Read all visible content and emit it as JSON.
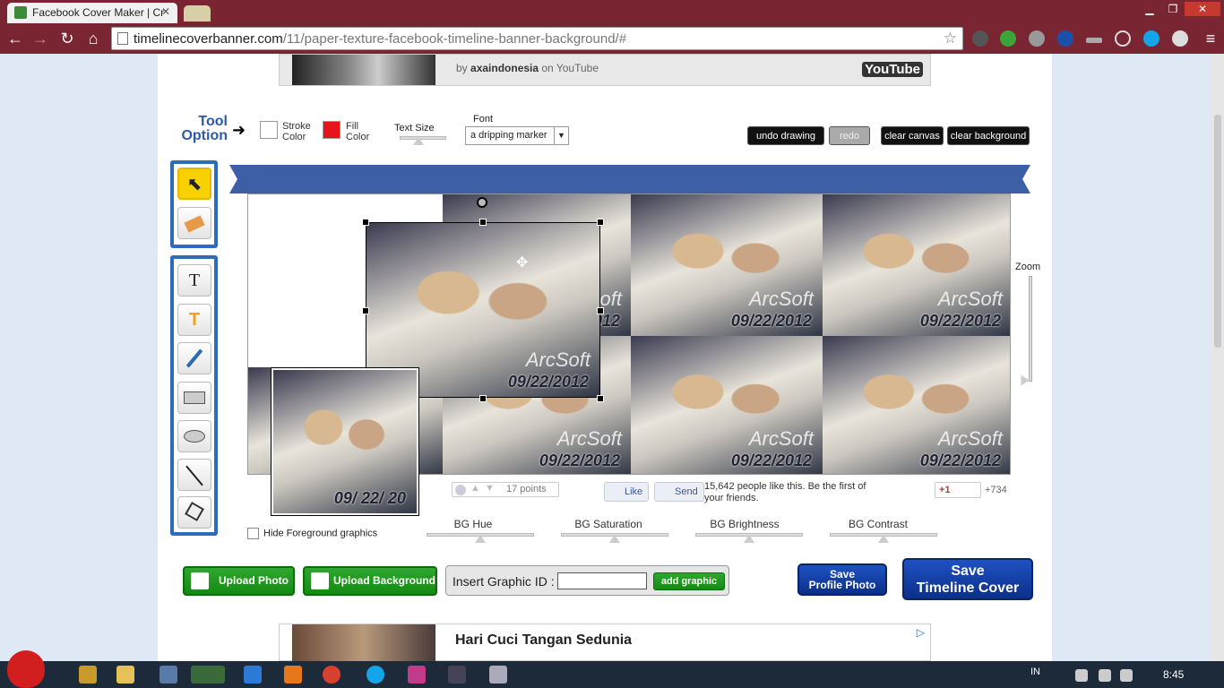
{
  "browser": {
    "tab_title": "Facebook Cover Maker | Cr",
    "tab_close": "✕",
    "url_host": "timelinecoverbanner.com",
    "url_path": "/11/paper-texture-facebook-timeline-banner-background/#",
    "window_buttons": {
      "minimize": "▁",
      "maximize": "❐",
      "close": "✕"
    },
    "nav": {
      "back": "←",
      "forward": "→",
      "reload": "↻",
      "home": "⌂"
    }
  },
  "video": {
    "by_prefix": "by ",
    "author": "axaindonesia",
    "on_suffix": " on YouTube",
    "logo": "YouTube"
  },
  "tool_options": {
    "title_line1": "Tool",
    "title_line2": "Option",
    "arrow": "➜",
    "stroke_label_1": "Stroke",
    "stroke_label_2": "Color",
    "fill_label_1": "Fill",
    "fill_label_2": "Color",
    "stroke_color": "#ffffff",
    "fill_color": "#e8141b",
    "text_size_label": "Text Size",
    "font_label": "Font",
    "font_value": "a dripping marker",
    "buttons": {
      "undo": "undo drawing",
      "redo": "redo",
      "clear_canvas": "clear canvas",
      "clear_background": "clear background"
    }
  },
  "tools": {
    "select": "⬉",
    "text": "T",
    "text_style": "T"
  },
  "canvas": {
    "watermark": "ArcSoft",
    "dates": [
      "09/22/2012",
      "09/22/2012",
      "09/22/2012",
      "09/22/2012",
      "09/22/2012",
      "09/22/2012",
      "09/22/2012",
      "09/ 22/ 20"
    ],
    "move_icon": "✥",
    "zoom_label": "Zoom"
  },
  "social": {
    "reddit_points": "17 points",
    "like": "Like",
    "send": "Send",
    "fb_text": "15,642 people like this. Be the first of your friends.",
    "gplus": "+1",
    "gplus_count": "+734"
  },
  "controls": {
    "hide_foreground": "Hide Foreground graphics",
    "bg_hue": "BG Hue",
    "bg_saturation": "BG Saturation",
    "bg_brightness": "BG Brightness",
    "bg_contrast": "BG Contrast"
  },
  "actions": {
    "upload_photo": "Upload  Photo",
    "upload_background": "Upload Background",
    "insert_graphic_label": "Insert Graphic ID :",
    "graphic_id_value": "",
    "add_graphic": "add graphic",
    "save_profile_line1": "Save",
    "save_profile_line2": "Profile Photo",
    "save_timeline_line1": "Save",
    "save_timeline_line2": "Timeline Cover"
  },
  "ad": {
    "title": "Hari Cuci Tangan Sedunia",
    "choice_icon": "▷"
  },
  "taskbar": {
    "language": "IN",
    "time": "8:45"
  },
  "colors": {
    "chrome_frame": "#7a2532",
    "banner_blue": "#3d5fa6",
    "tool_blue": "#2d6bbf",
    "green_button": "#138b13",
    "save_blue": "#0c2f8a"
  }
}
